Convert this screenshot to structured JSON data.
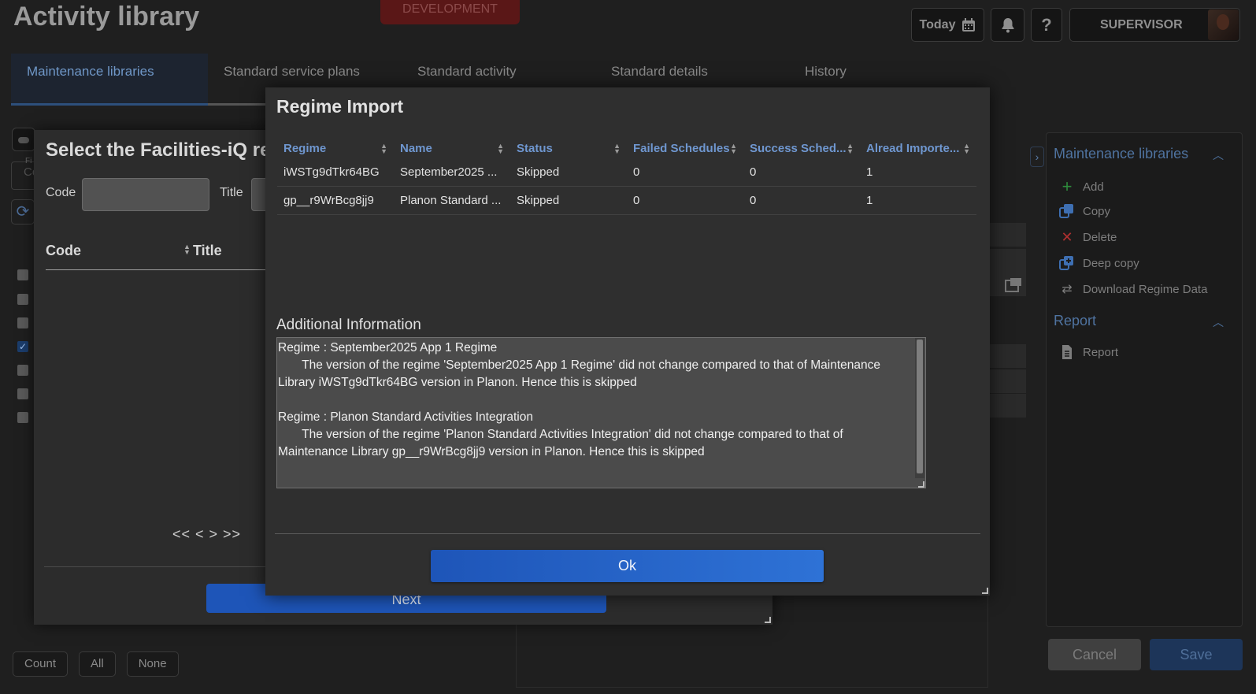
{
  "header": {
    "title": "Activity library",
    "environment": "DEVELOPMENT",
    "today_label": "Today",
    "help_label": "?",
    "user_label": "SUPERVISOR"
  },
  "tabs": [
    {
      "label": "Maintenance libraries",
      "active": true
    },
    {
      "label": "Standard service plans"
    },
    {
      "label": "Standard activity definitions"
    },
    {
      "label": "Standard details"
    },
    {
      "label": "History"
    }
  ],
  "left_panel": {
    "filter_label": "Fi",
    "filter_value": "Co"
  },
  "bottom_buttons": {
    "count": "Count",
    "all": "All",
    "none": "None"
  },
  "side_panel": {
    "section_libraries": "Maintenance libraries",
    "items": [
      {
        "label": "Add",
        "icon": "add-icon"
      },
      {
        "label": "Copy",
        "icon": "copy-icon"
      },
      {
        "label": "Delete",
        "icon": "delete-icon"
      },
      {
        "label": "Deep copy",
        "icon": "deep-copy-icon"
      },
      {
        "label": "Download Regime Data",
        "icon": "transfer-icon"
      }
    ],
    "section_report": "Report",
    "report_item": "Report"
  },
  "footer": {
    "cancel": "Cancel",
    "save": "Save"
  },
  "select_dialog": {
    "title": "Select the Facilities-iQ reg",
    "code_label": "Code",
    "title_label": "Title",
    "col_code": "Code",
    "col_title": "Title",
    "pager": "<< < > >>",
    "next": "Next"
  },
  "regime_import": {
    "title": "Regime Import",
    "columns": [
      "Regime",
      "Name",
      "Status",
      "Failed Schedules",
      "Success Sched...",
      "Alread Importe..."
    ],
    "rows": [
      [
        "iWSTg9dTkr64BG",
        "September2025 ...",
        "Skipped",
        "0",
        "0",
        "1"
      ],
      [
        "gp__r9WrBcg8jj9",
        "Planon Standard ...",
        "Skipped",
        "0",
        "0",
        "1"
      ]
    ],
    "additional_title": "Additional Information",
    "additional_text": "Regime : September2025 App 1 Regime\n       The version of the regime 'September2025 App 1 Regime' did not change compared to that of Maintenance Library iWSTg9dTkr64BG version in Planon. Hence this is skipped\n\nRegime : Planon Standard Activities Integration\n       The version of the regime 'Planon Standard Activities Integration' did not change compared to that of Maintenance Library gp__r9WrBcg8jj9 version in Planon. Hence this is skipped",
    "ok": "Ok"
  },
  "colors": {
    "accent": "#1e55b8",
    "link": "#6f97d0",
    "env_badge": "#5a1717"
  }
}
